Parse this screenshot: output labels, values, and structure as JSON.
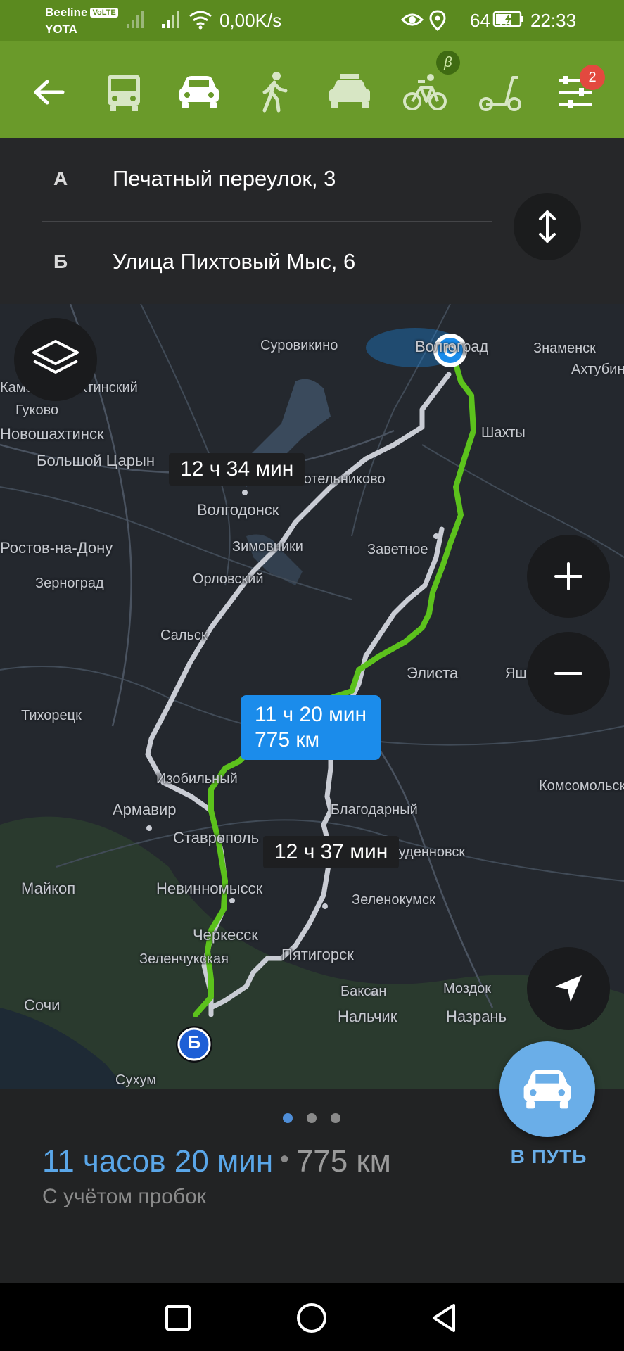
{
  "status_bar": {
    "carrier_1": "Beeline",
    "volte": "VoLTE",
    "carrier_2": "YOTA",
    "net_speed": "0,00K/s",
    "battery_percent": "64 %",
    "time": "22:33"
  },
  "transport_modes": {
    "items": [
      {
        "name": "back",
        "icon": "arrow-left-icon"
      },
      {
        "name": "bus",
        "icon": "bus-icon"
      },
      {
        "name": "car",
        "icon": "car-icon",
        "selected": true
      },
      {
        "name": "walk",
        "icon": "pedestrian-icon"
      },
      {
        "name": "taxi",
        "icon": "taxi-icon"
      },
      {
        "name": "bike",
        "icon": "bicycle-icon",
        "badge": "β"
      },
      {
        "name": "scooter",
        "icon": "scooter-icon"
      },
      {
        "name": "settings",
        "icon": "sliders-icon",
        "badge": "2"
      }
    ],
    "bike_badge": "β",
    "settings_badge": "2"
  },
  "route": {
    "from_letter": "А",
    "from_address": "Печатный переулок, 3",
    "to_letter": "Б",
    "to_address": "Улица Пихтовый Мыс, 6"
  },
  "map": {
    "place_labels": [
      {
        "text": "Суровикино"
      },
      {
        "text": "Волгоград"
      },
      {
        "text": "Знаменск"
      },
      {
        "text": "Ахтубинск"
      },
      {
        "text": "Каменск-Шахтинский"
      },
      {
        "text": "Гуково"
      },
      {
        "text": "Новошахтинск"
      },
      {
        "text": "Большой Царын"
      },
      {
        "text": "Шахты"
      },
      {
        "text": "Котельниково"
      },
      {
        "text": "Волгодонск"
      },
      {
        "text": "Ростов-на-Дону"
      },
      {
        "text": "Зимовники"
      },
      {
        "text": "Заветное"
      },
      {
        "text": "Зерноград"
      },
      {
        "text": "Орловский"
      },
      {
        "text": "Сальск"
      },
      {
        "text": "Элиста"
      },
      {
        "text": "Яшкуль"
      },
      {
        "text": "Тихорецк"
      },
      {
        "text": "Изобильный"
      },
      {
        "text": "Комсомольский"
      },
      {
        "text": "Армавир"
      },
      {
        "text": "Благодарный"
      },
      {
        "text": "Ставрополь"
      },
      {
        "text": "Буденновск"
      },
      {
        "text": "Майкоп"
      },
      {
        "text": "Невинномысск"
      },
      {
        "text": "Зеленокумск"
      },
      {
        "text": "Черкесск"
      },
      {
        "text": "Пятигорск"
      },
      {
        "text": "Зеленчукская"
      },
      {
        "text": "Баксан"
      },
      {
        "text": "Моздок"
      },
      {
        "text": "Сочи"
      },
      {
        "text": "Нальчик"
      },
      {
        "text": "Назрань"
      },
      {
        "text": "Сухум"
      }
    ],
    "alt_route_1_time": "12 ч 34 мин",
    "alt_route_2_time": "12 ч 37 мин",
    "main_route_time": "11 ч 20 мин",
    "main_route_distance": "775 км",
    "start_marker": "А",
    "end_marker": "Б",
    "colors": {
      "main_route": "#5cc21c",
      "alt_route": "#c9ccd4",
      "accent_blue": "#1b8ceb"
    }
  },
  "bottom_sheet": {
    "page_dots": 3,
    "active_dot": 0,
    "duration": "11 часов 20 мин",
    "separator": "•",
    "distance": "775 км",
    "traffic_note": "С учётом пробок",
    "go_label": "В ПУТЬ"
  },
  "nav_bar": {
    "items": [
      "recent-apps-icon",
      "home-icon",
      "back-icon"
    ]
  }
}
